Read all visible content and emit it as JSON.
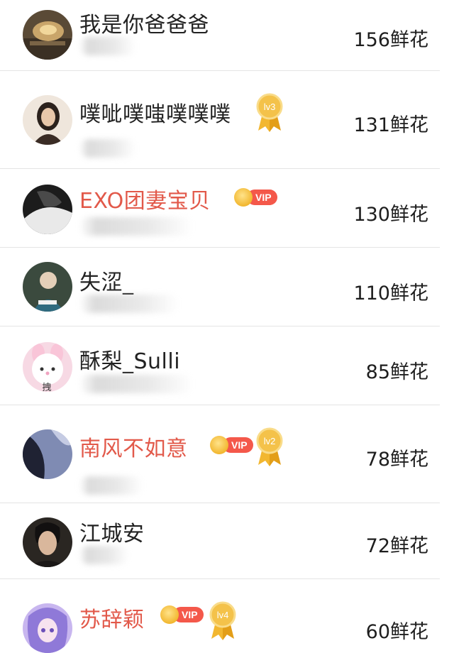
{
  "ranking": {
    "entries": [
      {
        "name": "我是你爸爸爸",
        "score": "156鲜花",
        "vip": false,
        "level": ""
      },
      {
        "name": "噗呲噗嗤噗噗噗",
        "score": "131鲜花",
        "vip": false,
        "level": "lv3"
      },
      {
        "name": "EXO团妻宝贝",
        "score": "130鲜花",
        "vip": true,
        "vip_label": "VIP",
        "level": ""
      },
      {
        "name": "失涩_",
        "score": "110鲜花",
        "vip": false,
        "level": ""
      },
      {
        "name": "酥梨_Sulli",
        "score": "85鲜花",
        "vip": false,
        "level": "",
        "avatar_text": "拽"
      },
      {
        "name": "南风不如意",
        "score": "78鲜花",
        "vip": true,
        "vip_label": "VIP",
        "level": "lv2"
      },
      {
        "name": "江城安",
        "score": "72鲜花",
        "vip": false,
        "level": ""
      },
      {
        "name": "苏辞颖",
        "score": "60鲜花",
        "vip": true,
        "vip_label": "VIP",
        "level": "lv4"
      }
    ]
  },
  "colors": {
    "vip_name": "#e2594a",
    "normal_name": "#222222",
    "vip_badge": "#f4584a",
    "medal_gold": "#f2b730",
    "divider": "#e4e4e4"
  },
  "icons": {
    "vip": "crown-icon",
    "medal": "medal-icon"
  }
}
